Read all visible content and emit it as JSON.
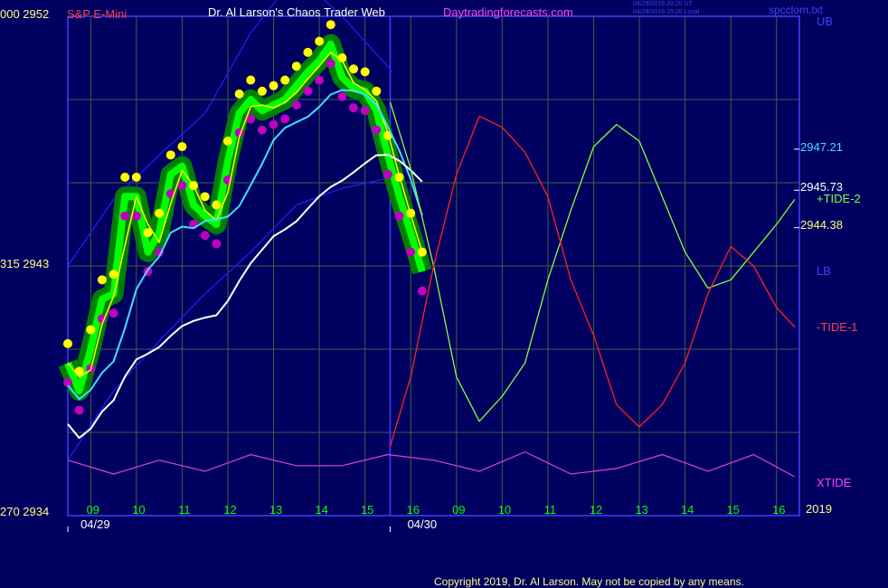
{
  "header": {
    "left_price_pair": "000  2952",
    "symbol": "S&P E-Mini",
    "title": "Dr. Al Larson's Chaos Trader Web",
    "site": "Daytradingforecasts.com",
    "timestamp_ut": "04/29/2019 20:20 UT",
    "timestamp_local": "04/29/2019 15:20 Local",
    "file": "spcclom.txt",
    "ub_label": "UB"
  },
  "left_axis": {
    "mid_label": "315  2943",
    "bottom_label": "270  2934"
  },
  "right_labels": {
    "v1": "2947.21",
    "v2": "2945.73",
    "tide2": "+TIDE-2",
    "v3": "2944.38",
    "lb": "LB",
    "tide1": "-TIDE-1",
    "xtide": "XTIDE",
    "year": "2019"
  },
  "colors": {
    "background": "#000060",
    "frame": "#4040ff",
    "grid": "#406040",
    "price_candle": "#00ff00",
    "highs": "#ffff00",
    "lows": "#c000c0",
    "fast_avg": "#ffff00",
    "slow_avg": "#40e0ff",
    "long_avg": "#ffffff",
    "tide_plus": "#80ff40",
    "tide_minus": "#ff2020",
    "xtide": "#e040e0",
    "band": "#2020ff"
  },
  "footer": {
    "copyright": "Copyright 2019, Dr. Al Larson. May not be copied by any means."
  },
  "chart_data": {
    "type": "line",
    "title": "S&P E-Mini",
    "ylim": [
      2934,
      2952
    ],
    "y_ticks": [
      2934,
      2943,
      2952
    ],
    "x_ticks": [
      "09",
      "10",
      "11",
      "12",
      "13",
      "14",
      "15",
      "16",
      "09",
      "10",
      "11",
      "12",
      "13",
      "14",
      "15",
      "16"
    ],
    "date_labels": [
      "04/29",
      "04/30"
    ],
    "grid": true,
    "annotated_levels": [
      2947.21,
      2945.73,
      2944.38
    ],
    "series": [
      {
        "name": "price",
        "x": [
          0,
          0.25,
          0.5,
          0.75,
          1,
          1.25,
          1.5,
          1.75,
          2,
          2.25,
          2.5,
          2.75,
          3,
          3.25,
          3.5,
          3.75,
          4,
          4.25,
          4.5,
          4.75,
          5,
          5.25,
          5.5,
          5.75,
          6,
          6.25,
          6.5,
          6.75,
          7,
          7.25,
          7.5,
          7.75
        ],
        "y": [
          2939.5,
          2938.5,
          2940,
          2941.8,
          2942,
          2945.5,
          2945.5,
          2943.5,
          2944.2,
          2946.3,
          2946.6,
          2945.2,
          2944.8,
          2944.5,
          2946.8,
          2948.5,
          2949.0,
          2948.6,
          2948.8,
          2949.0,
          2949.5,
          2950.0,
          2950.4,
          2951.0,
          2949.8,
          2949.4,
          2949.3,
          2948.6,
          2947.0,
          2945.5,
          2944.2,
          2942.8
        ]
      },
      {
        "name": "UB",
        "x": [
          0,
          1,
          2,
          3,
          4,
          5,
          6,
          7.1
        ],
        "y": [
          2943,
          2945.4,
          2947,
          2948.5,
          2951.4,
          2953.5,
          2952,
          2950
        ]
      },
      {
        "name": "LB",
        "x": [
          0,
          1,
          2,
          3,
          4,
          5,
          6,
          7.1
        ],
        "y": [
          2936,
          2938.5,
          2940.3,
          2942,
          2943.5,
          2945.2,
          2945.8,
          2946.2
        ]
      },
      {
        "name": "+TIDE-2",
        "x": [
          7.05,
          7.5,
          8,
          8.5,
          9,
          9.5,
          10,
          10.5,
          11,
          11.5,
          12,
          12.5,
          13,
          13.5,
          14,
          14.5,
          15,
          15.5,
          15.9
        ],
        "y": [
          2948.9,
          2946.5,
          2943,
          2939,
          2937.4,
          2938.3,
          2939.5,
          2942.5,
          2945,
          2947.3,
          2948.1,
          2947.5,
          2945.5,
          2943.5,
          2942.2,
          2942.5,
          2943.5,
          2944.5,
          2945.4
        ]
      },
      {
        "name": "-TIDE-1",
        "x": [
          7.05,
          7.5,
          8,
          8.5,
          9,
          9.5,
          10,
          10.5,
          11,
          11.5,
          12,
          12.5,
          13,
          13.5,
          14,
          14.5,
          15,
          15.5,
          15.9
        ],
        "y": [
          2936.5,
          2939,
          2943,
          2946.3,
          2948.4,
          2948,
          2947.1,
          2945.5,
          2942.5,
          2940.5,
          2938,
          2937.2,
          2938,
          2939.5,
          2942,
          2943.7,
          2943,
          2941.5,
          2940.8
        ]
      },
      {
        "name": "XTIDE",
        "x": [
          0,
          1,
          2,
          3,
          4,
          5,
          6,
          7,
          8,
          9,
          10,
          11,
          12,
          13,
          14,
          15,
          15.9
        ],
        "y": [
          2936,
          2935.5,
          2936,
          2935.6,
          2936.2,
          2935.8,
          2935.8,
          2936.2,
          2936,
          2935.6,
          2936.3,
          2935.5,
          2935.7,
          2936.2,
          2935.6,
          2936.2,
          2935.4
        ]
      }
    ]
  }
}
